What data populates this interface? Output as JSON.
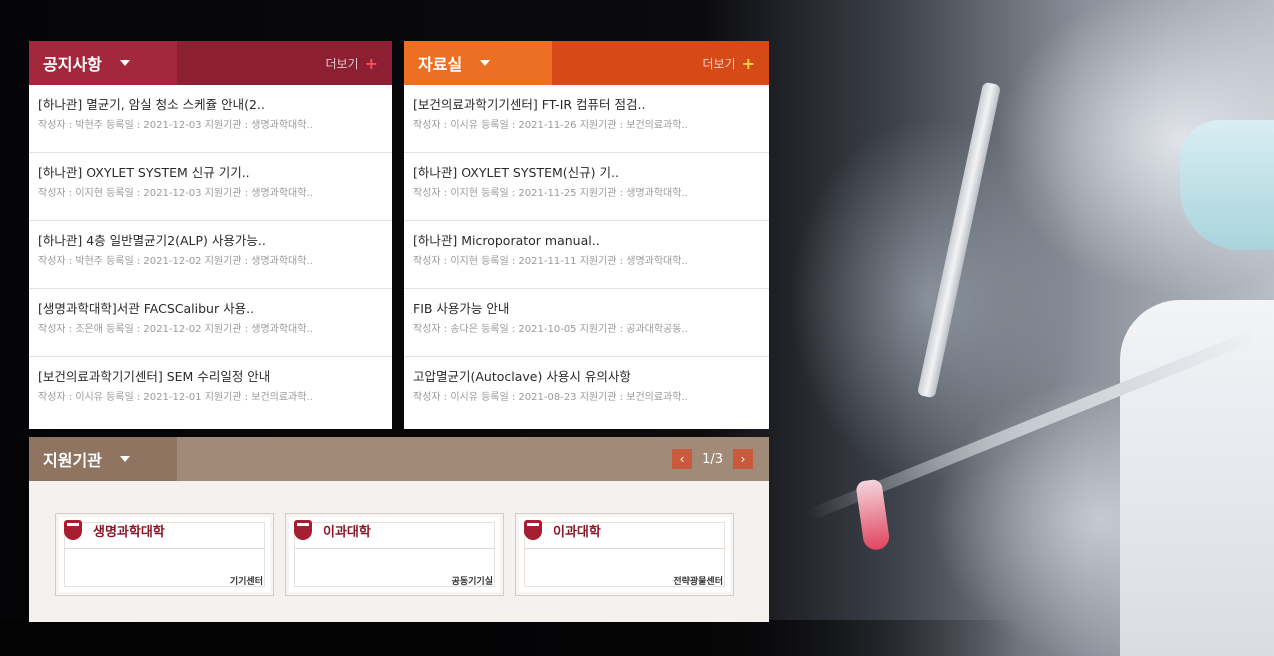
{
  "notice": {
    "tab_label": "공지사항",
    "more_label": "더보기",
    "items": [
      {
        "title": "[하나관] 멸균기, 암실 청소 스케쥴 안내(2..",
        "meta": "작성자 : 박현주 등록일 : 2021-12-03 지원기관 : 생명과학대학.."
      },
      {
        "title": "[하나관] OXYLET SYSTEM 신규 기기..",
        "meta": "작성자 : 이지현 등록일 : 2021-12-03 지원기관 : 생명과학대학.."
      },
      {
        "title": "[하나관] 4층 일반멸균기2(ALP) 사용가능..",
        "meta": "작성자 : 박현주 등록일 : 2021-12-02 지원기관 : 생명과학대학.."
      },
      {
        "title": "[생명과학대학]서관 FACSCalibur 사용..",
        "meta": "작성자 : 조은애 등록일 : 2021-12-02 지원기관 : 생명과학대학.."
      },
      {
        "title": "[보건의료과학기기센터] SEM 수리일정 안내",
        "meta": "작성자 : 이시유 등록일 : 2021-12-01 지원기관 : 보건의료과학.."
      }
    ]
  },
  "files": {
    "tab_label": "자료실",
    "more_label": "더보기",
    "items": [
      {
        "title": "[보건의료과학기기센터] FT-IR 컴퓨터 점검..",
        "meta": "작성자 : 이시유 등록일 : 2021-11-26 지원기관 : 보건의료과학.."
      },
      {
        "title": "[하나관] OXYLET SYSTEM(신규) 기..",
        "meta": "작성자 : 이지현 등록일 : 2021-11-25 지원기관 : 생명과학대학.."
      },
      {
        "title": "[하나관] Microporator manual..",
        "meta": "작성자 : 이지현 등록일 : 2021-11-11 지원기관 : 생명과학대학.."
      },
      {
        "title": "FIB 사용가능 안내",
        "meta": "작성자 : 송다은 등록일 : 2021-10-05 지원기관 : 공과대학공동.."
      },
      {
        "title": "고압멸균기(Autoclave) 사용시 유의사항",
        "meta": "작성자 : 이시유 등록일 : 2021-08-23 지원기관 : 보건의료과학.."
      }
    ]
  },
  "support": {
    "tab_label": "지원기관",
    "page_indicator": "1/3",
    "prev_icon": "‹",
    "next_icon": "›",
    "cards": [
      {
        "name": "생명과학대학",
        "sub": "기기센터"
      },
      {
        "name": "이과대학",
        "sub": "공동기기실"
      },
      {
        "name": "이과대학",
        "sub": "전략광물센터"
      }
    ]
  },
  "icons": {
    "caret": "caret-down-icon",
    "plus": "+",
    "emblem": "university-emblem-icon"
  },
  "colors": {
    "notice_accent": "#a4283d",
    "files_accent": "#ec6f24",
    "support_accent": "#8f7462",
    "pager_button": "#c95a3c"
  }
}
